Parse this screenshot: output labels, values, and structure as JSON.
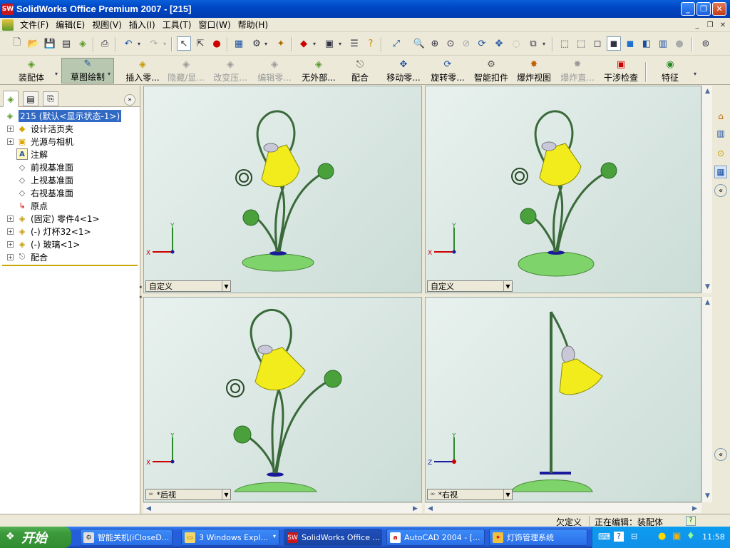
{
  "app": {
    "title": "SolidWorks Office Premium 2007 - [215]",
    "icon_label": "SW"
  },
  "menu": [
    "文件(F)",
    "编辑(E)",
    "视图(V)",
    "插入(I)",
    "工具(T)",
    "窗口(W)",
    "帮助(H)"
  ],
  "command_manager": {
    "assembly_tab": "装配体",
    "sketch_tab": "草图绘制",
    "commands": [
      {
        "label": "插入零...",
        "enabled": true,
        "icon": "insert-component-icon"
      },
      {
        "label": "隐藏/显...",
        "enabled": false,
        "icon": "hide-show-icon"
      },
      {
        "label": "改变压...",
        "enabled": false,
        "icon": "change-suppression-icon"
      },
      {
        "label": "编辑零...",
        "enabled": false,
        "icon": "edit-component-icon"
      },
      {
        "label": "无外部...",
        "enabled": true,
        "icon": "no-external-references-icon"
      },
      {
        "label": "配合",
        "enabled": true,
        "icon": "mate-icon"
      },
      {
        "label": "移动零...",
        "enabled": true,
        "icon": "move-component-icon"
      },
      {
        "label": "旋转零...",
        "enabled": true,
        "icon": "rotate-component-icon"
      },
      {
        "label": "智能扣件",
        "enabled": true,
        "icon": "smart-fasteners-icon"
      },
      {
        "label": "爆炸视图",
        "enabled": true,
        "icon": "exploded-view-icon"
      },
      {
        "label": "爆炸直...",
        "enabled": false,
        "icon": "explode-line-sketch-icon"
      },
      {
        "label": "干涉检查",
        "enabled": true,
        "icon": "interference-detection-icon"
      },
      {
        "label": "特征",
        "enabled": true,
        "icon": "features-icon"
      }
    ]
  },
  "feature_tree": {
    "root": "215 (默认<显示状态-1>)",
    "items": [
      {
        "label": "设计活页夹",
        "expandable": true,
        "icon": "design-binder-icon"
      },
      {
        "label": "光源与相机",
        "expandable": true,
        "icon": "lights-cameras-icon"
      },
      {
        "label": "注解",
        "expandable": false,
        "icon": "annotations-icon"
      },
      {
        "label": "前视基准面",
        "expandable": false,
        "icon": "plane-icon"
      },
      {
        "label": "上视基准面",
        "expandable": false,
        "icon": "plane-icon"
      },
      {
        "label": "右视基准面",
        "expandable": false,
        "icon": "plane-icon"
      },
      {
        "label": "原点",
        "expandable": false,
        "icon": "origin-icon"
      },
      {
        "label": "(固定) 零件4<1>",
        "expandable": true,
        "icon": "part-icon"
      },
      {
        "label": "(-) 灯杯32<1>",
        "expandable": true,
        "icon": "part-icon"
      },
      {
        "label": "(-) 玻璃<1>",
        "expandable": true,
        "icon": "part-icon"
      },
      {
        "label": "配合",
        "expandable": true,
        "icon": "mates-folder-icon"
      }
    ]
  },
  "viewports": [
    {
      "name": "top-left",
      "view": "自定义",
      "axes": [
        "X",
        "Y"
      ]
    },
    {
      "name": "top-right",
      "view": "自定义",
      "axes": [
        "X",
        "Y"
      ]
    },
    {
      "name": "bottom-left",
      "view": "*后视",
      "axes": [
        "X",
        "Y"
      ]
    },
    {
      "name": "bottom-right",
      "view": "*右视",
      "axes": [
        "Z",
        "Y"
      ]
    }
  ],
  "status": {
    "underdefined": "欠定义",
    "editing": "正在编辑：装配体",
    "help": "?"
  },
  "taskbar": {
    "start": "开始",
    "tasks": [
      {
        "label": "智能关机(iCloseD...",
        "active": false
      },
      {
        "label": "3 Windows Expl...",
        "active": false
      },
      {
        "label": "SolidWorks Office ...",
        "active": true
      },
      {
        "label": "AutoCAD 2004 - [...",
        "active": false
      },
      {
        "label": "灯饰管理系统",
        "active": false
      }
    ],
    "clock": "11:58"
  },
  "colors": {
    "lamp_green": "#7ed36a",
    "lamp_yellow": "#f2ec1c",
    "titlebar_blue": "#0a5fd8",
    "selection_blue": "#316ac5"
  }
}
